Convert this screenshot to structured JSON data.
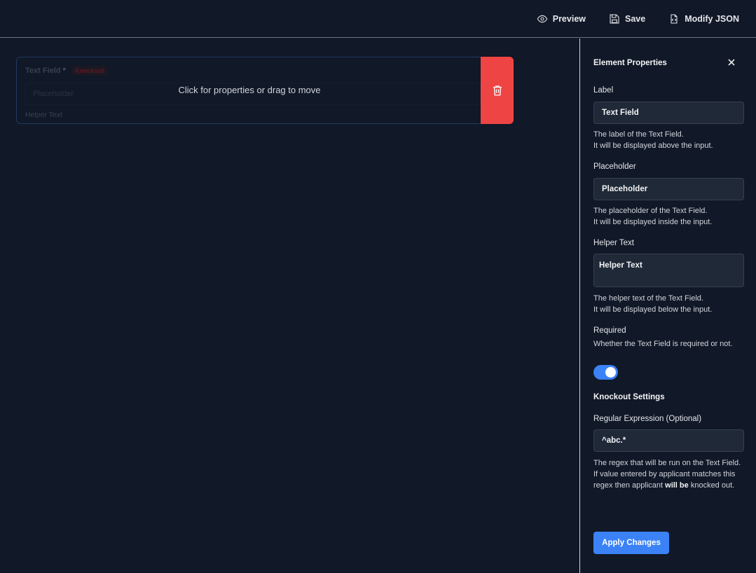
{
  "toolbar": {
    "preview_label": "Preview",
    "save_label": "Save",
    "modify_json_label": "Modify JSON"
  },
  "canvas": {
    "field": {
      "label": "Text Field",
      "required_mark": "*",
      "badge": "Knockout",
      "placeholder": "Placeholder",
      "helper": "Helper Text"
    },
    "overlay_hint": "Click for properties or drag to move",
    "delete_icon": "trash-icon",
    "delete_color": "#ef4444"
  },
  "panel": {
    "title": "Element Properties",
    "label": {
      "title": "Label",
      "value": "Text Field",
      "desc_line1": "The label of the Text Field.",
      "desc_line2": "It will be displayed above the input."
    },
    "placeholder": {
      "title": "Placeholder",
      "value": "Placeholder",
      "desc_line1": "The placeholder of the Text Field.",
      "desc_line2": "It will be displayed inside the input."
    },
    "helper": {
      "title": "Helper Text",
      "value": "Helper Text",
      "desc_line1": "The helper text of the Text Field.",
      "desc_line2": "It will be displayed below the input."
    },
    "required": {
      "title": "Required",
      "desc": "Whether the Text Field is required or not.",
      "enabled": true
    },
    "knockout": {
      "section_title": "Knockout Settings",
      "regex_title": "Regular Expression (Optional)",
      "regex_value": "^abc.*",
      "desc_line1": "The regex that will be run on the Text Field.",
      "desc_line2_pre": "If value entered by applicant matches this regex then applicant",
      "desc_line2_bold": "will be",
      "desc_line2_post": "knocked out."
    },
    "apply_label": "Apply Changes",
    "accent": "#3b82f6"
  }
}
